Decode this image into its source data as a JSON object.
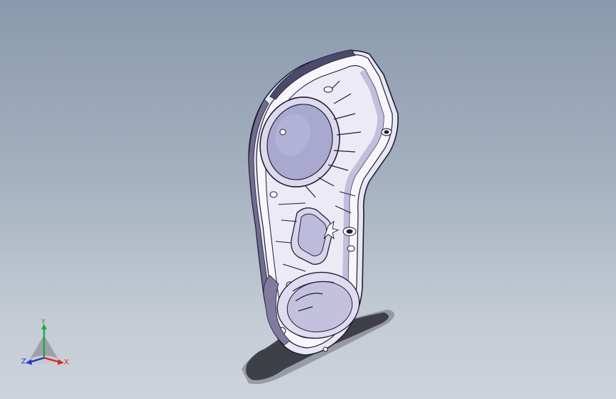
{
  "viewport": {
    "background_top": "#8a99ad",
    "background_bottom": "#cdd3da"
  },
  "model": {
    "part_fill": "#f7f6fb",
    "edge_color": "#1e1c3a",
    "shade_color": "#b7b4d6",
    "window_color": "#a9a9cf"
  },
  "triad": {
    "x_label": "X",
    "y_label": "Y",
    "z_label": "Z",
    "x_color": "#d8262b",
    "y_color": "#1fa83a",
    "z_color": "#2038c8"
  }
}
